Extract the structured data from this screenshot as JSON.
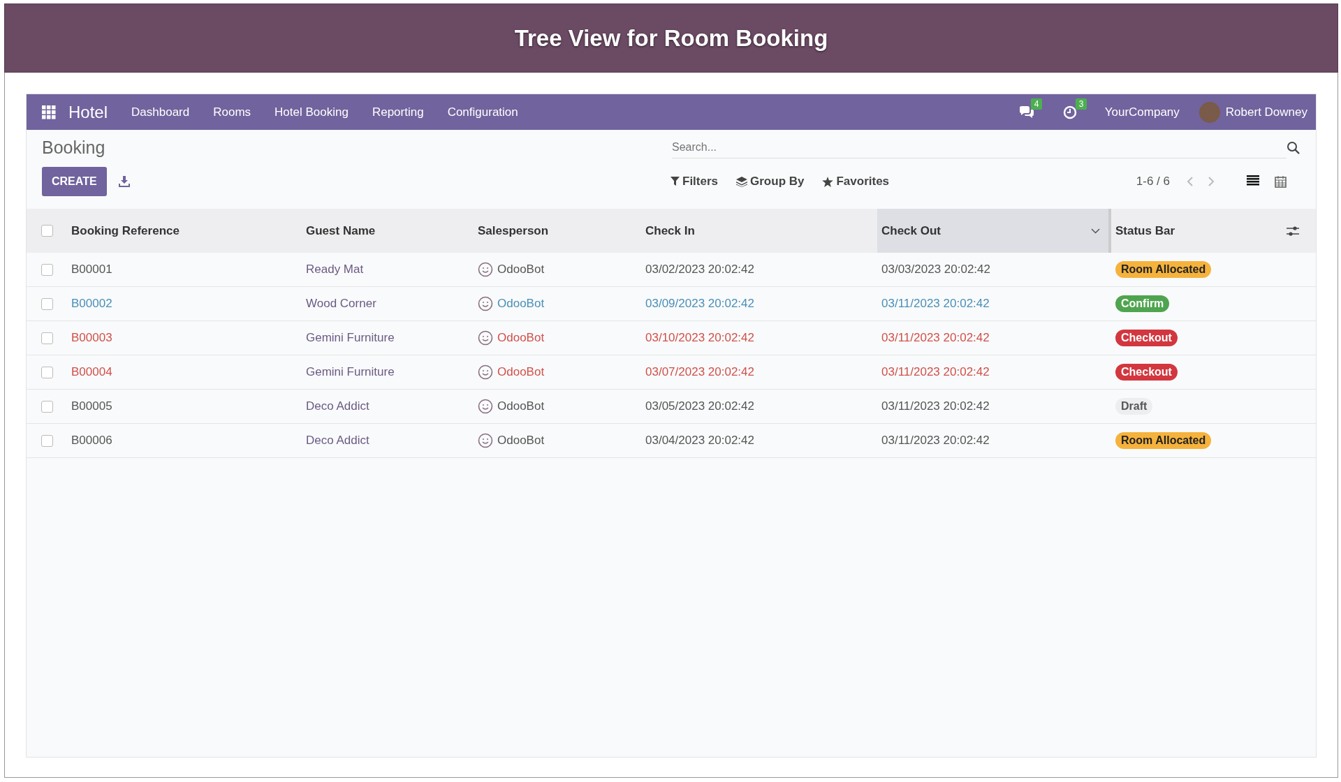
{
  "banner": {
    "title": "Tree View for Room Booking"
  },
  "navbar": {
    "app_name": "Hotel",
    "menu": [
      "Dashboard",
      "Rooms",
      "Hotel Booking",
      "Reporting",
      "Configuration"
    ],
    "messages_count": "4",
    "activities_count": "3",
    "company": "YourCompany",
    "user": "Robert Downey"
  },
  "control_panel": {
    "breadcrumb": "Booking",
    "create_button": "CREATE",
    "search": {
      "placeholder": "Search..."
    },
    "filters": [
      "Filters",
      "Group By",
      "Favorites"
    ],
    "pager": "1-6 / 6",
    "views": [
      {
        "kind": "list",
        "selected": true
      },
      {
        "kind": "calendar",
        "selected": false
      }
    ]
  },
  "table": {
    "select_all_checked": false,
    "columns": [
      {
        "label": "Booking Reference",
        "sorted": false
      },
      {
        "label": "Guest Name",
        "sorted": false
      },
      {
        "label": "Salesperson",
        "sorted": false
      },
      {
        "label": "Check In",
        "sorted": false
      },
      {
        "label": "Check Out",
        "sorted": true
      },
      {
        "label": "Status Bar",
        "sorted": false
      }
    ],
    "rows": [
      {
        "checked": false,
        "kind": "none",
        "reference": "B00001",
        "guest": "Ready Mat",
        "salesperson": "OdooBot",
        "check_in": "03/02/2023 20:02:42",
        "check_out": "03/03/2023 20:02:42",
        "status": {
          "label": "Room Allocated",
          "kind": "warning"
        }
      },
      {
        "checked": false,
        "kind": "info",
        "reference": "B00002",
        "guest": "Wood Corner",
        "salesperson": "OdooBot",
        "check_in": "03/09/2023 20:02:42",
        "check_out": "03/11/2023 20:02:42",
        "status": {
          "label": "Confirm",
          "kind": "success"
        }
      },
      {
        "checked": false,
        "kind": "danger",
        "reference": "B00003",
        "guest": "Gemini Furniture",
        "salesperson": "OdooBot",
        "check_in": "03/10/2023 20:02:42",
        "check_out": "03/11/2023 20:02:42",
        "status": {
          "label": "Checkout",
          "kind": "danger"
        }
      },
      {
        "checked": false,
        "kind": "danger",
        "reference": "B00004",
        "guest": "Gemini Furniture",
        "salesperson": "OdooBot",
        "check_in": "03/07/2023 20:02:42",
        "check_out": "03/11/2023 20:02:42",
        "status": {
          "label": "Checkout",
          "kind": "danger"
        }
      },
      {
        "checked": false,
        "kind": "none",
        "reference": "B00005",
        "guest": "Deco Addict",
        "salesperson": "OdooBot",
        "check_in": "03/05/2023 20:02:42",
        "check_out": "03/11/2023 20:02:42",
        "status": {
          "label": "Draft",
          "kind": "muted"
        }
      },
      {
        "checked": false,
        "kind": "none",
        "reference": "B00006",
        "guest": "Deco Addict",
        "salesperson": "OdooBot",
        "check_in": "03/04/2023 20:02:42",
        "check_out": "03/11/2023 20:02:42",
        "status": {
          "label": "Room Allocated",
          "kind": "warning"
        }
      }
    ]
  }
}
